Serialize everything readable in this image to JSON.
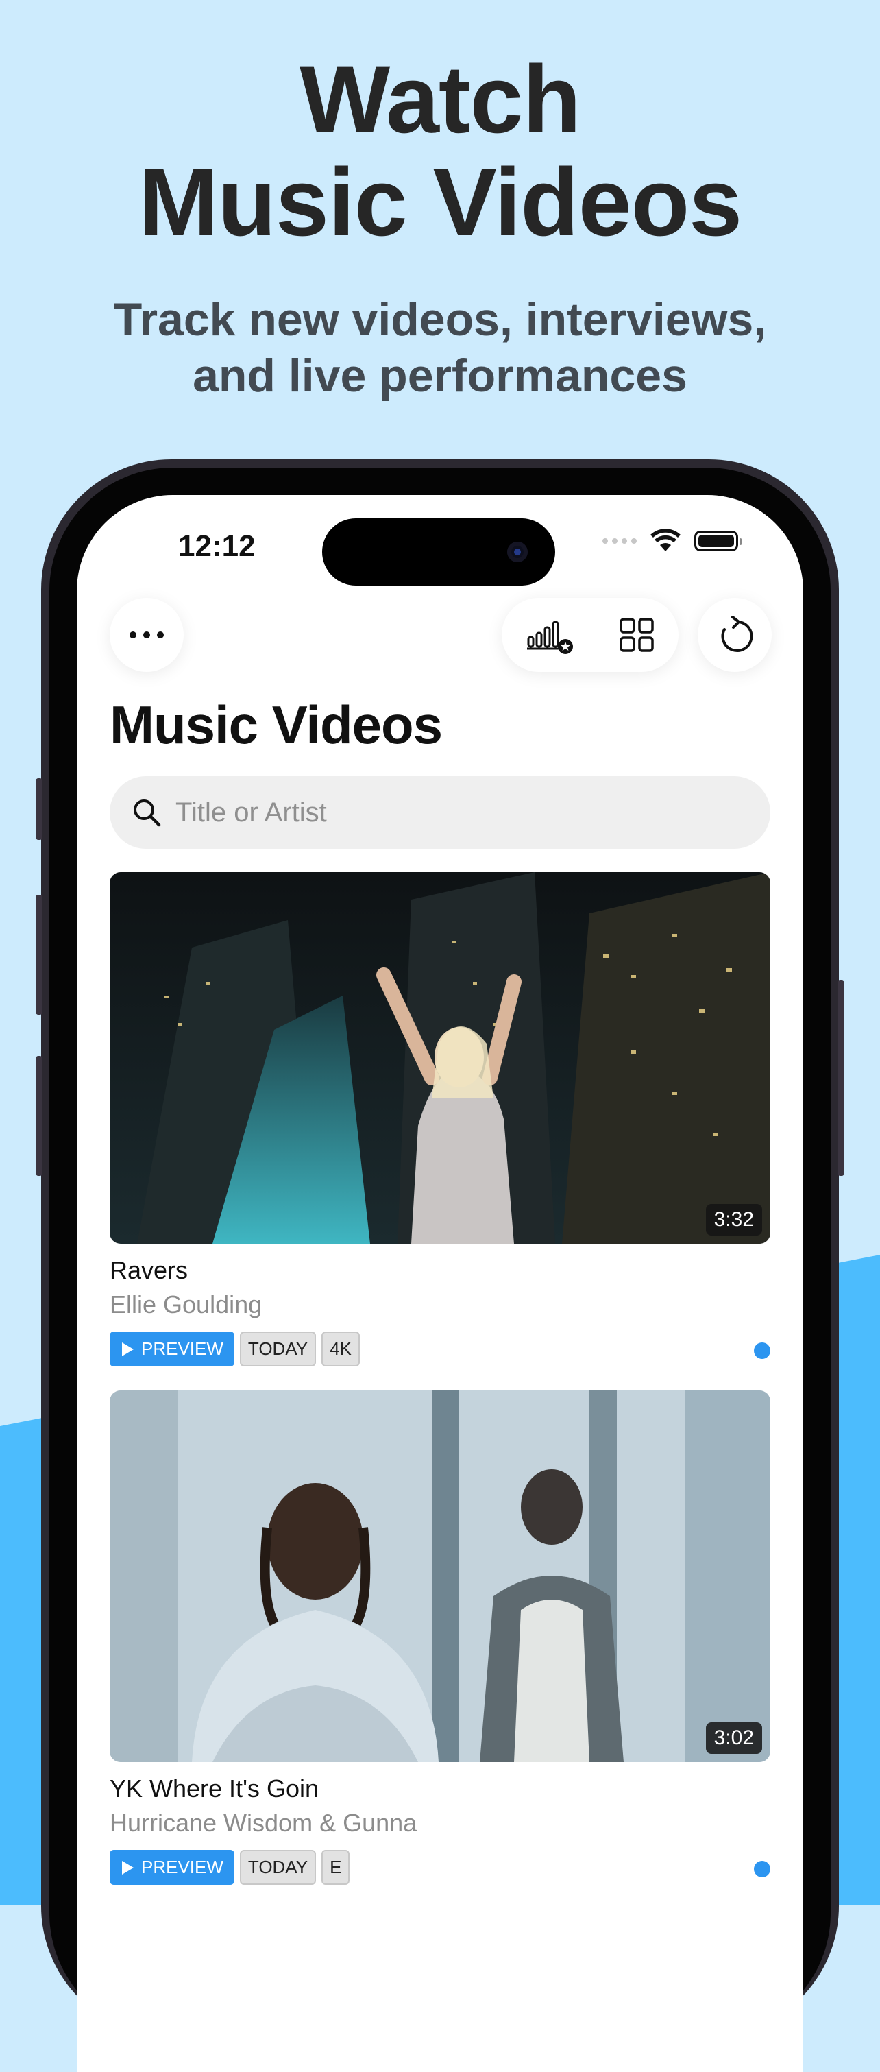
{
  "marketing": {
    "headline_line1": "Watch",
    "headline_line2": "Music Videos",
    "subhead_line1": "Track new videos, interviews,",
    "subhead_line2": "and live performances"
  },
  "status_bar": {
    "time": "12:12"
  },
  "toolbar": {
    "more_icon": "ellipsis-icon",
    "chart_icon": "chart-star-icon",
    "grid_icon": "grid-icon",
    "refresh_icon": "refresh-icon"
  },
  "page": {
    "title": "Music Videos"
  },
  "search": {
    "placeholder": "Title or Artist"
  },
  "videos": [
    {
      "title": "Ravers",
      "artist": "Ellie Goulding",
      "duration": "3:32",
      "tags": [
        "PREVIEW",
        "TODAY",
        "4K"
      ]
    },
    {
      "title": "YK Where It's Goin",
      "artist": "Hurricane Wisdom & Gunna",
      "duration": "3:02",
      "tags": [
        "PREVIEW",
        "TODAY",
        "E"
      ]
    }
  ],
  "colors": {
    "background": "#cdebfd",
    "accent_wave": "#4cbcfd",
    "preview_badge": "#2c95f0",
    "unread_dot": "#2c95f0"
  }
}
